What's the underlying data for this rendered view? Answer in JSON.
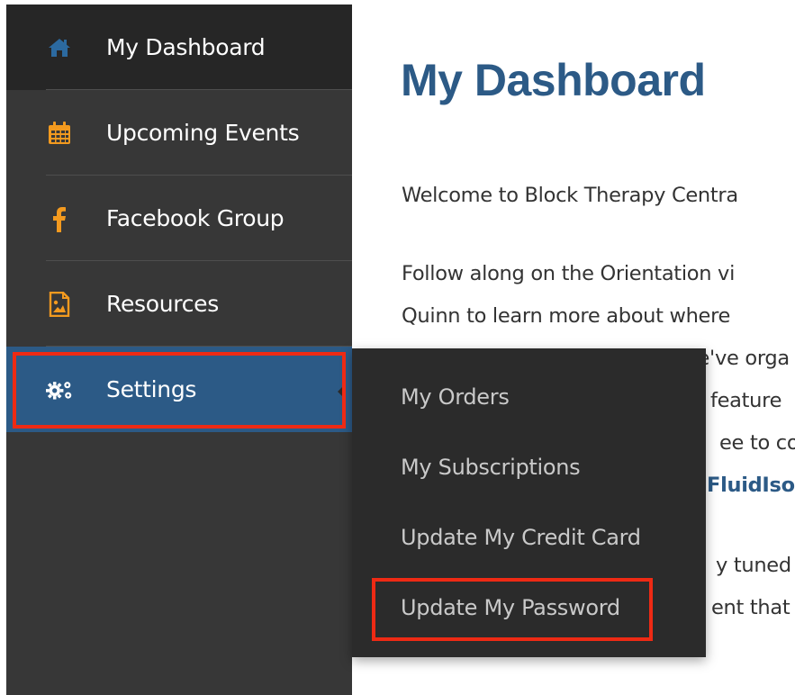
{
  "sidebar": {
    "items": [
      {
        "label": "My Dashboard",
        "icon": "home-icon"
      },
      {
        "label": "Upcoming Events",
        "icon": "calendar-icon"
      },
      {
        "label": "Facebook Group",
        "icon": "facebook-icon"
      },
      {
        "label": "Resources",
        "icon": "image-file-icon"
      },
      {
        "label": "Settings",
        "icon": "gears-icon"
      }
    ]
  },
  "main": {
    "title": "My Dashboard",
    "lines": [
      "Welcome to Block Therapy Centra",
      "Follow along on the Orientation vi",
      "Quinn to learn more about where",
      "... we've orga",
      "feature",
      "ee to co",
      "FluidIso",
      "y tuned",
      "ent that"
    ]
  },
  "settings_menu": {
    "items": [
      "My Orders",
      "My Subscriptions",
      "Update My Credit Card",
      "Update My Password"
    ]
  },
  "colors": {
    "accent": "#2c5a86",
    "orange": "#f39a1f",
    "highlight": "#ee2a14"
  }
}
